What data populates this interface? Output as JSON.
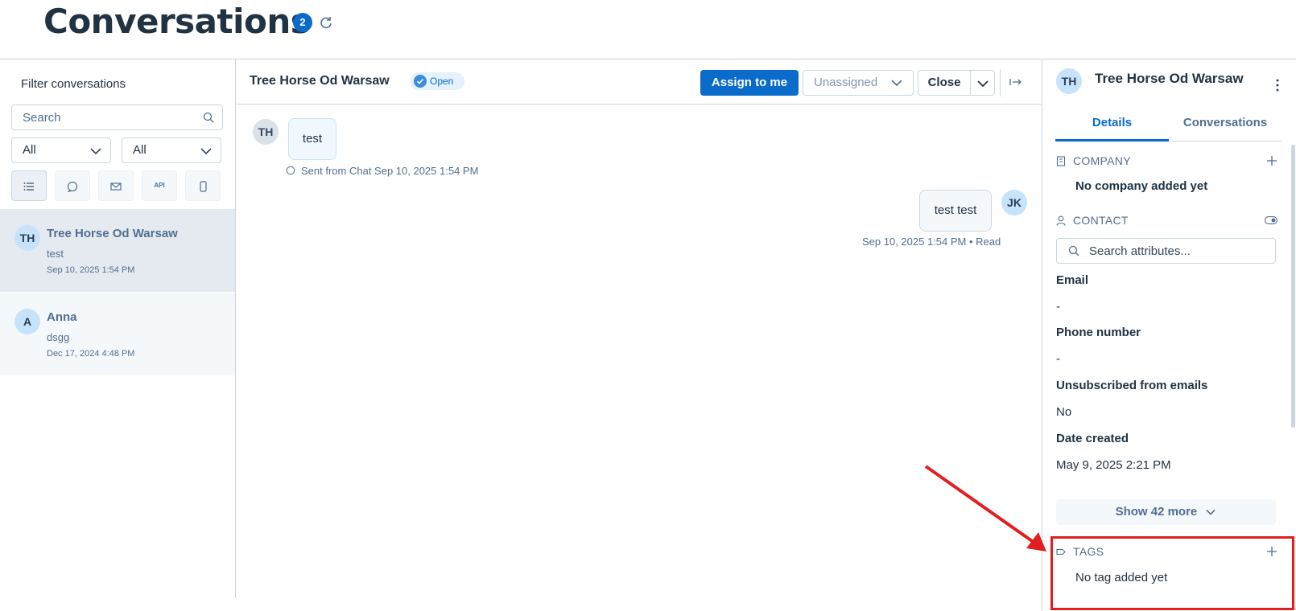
{
  "header": {
    "title": "Conversations",
    "count": "2"
  },
  "filter": {
    "title": "Filter conversations",
    "search_placeholder": "Search",
    "select_1": "All",
    "select_2": "All",
    "channels": [
      "list-icon",
      "chat-icon",
      "email-icon",
      "API",
      "mobile-icon"
    ]
  },
  "conversations": [
    {
      "initials": "TH",
      "name": "Tree Horse Od Warsaw",
      "snippet": "test",
      "date": "Sep 10, 2025 1:54 PM"
    },
    {
      "initials": "A",
      "name": "Anna",
      "snippet": "dsgg",
      "date": "Dec 17, 2024 4:48 PM"
    }
  ],
  "thread": {
    "title": "Tree Horse Od Warsaw",
    "status": "Open",
    "assign_label": "Assign to me",
    "assignee": "Unassigned",
    "close_label": "Close",
    "messages": [
      {
        "initials": "TH",
        "text": "test",
        "meta": "Sent from Chat Sep 10, 2025 1:54 PM"
      },
      {
        "initials": "JK",
        "text": "test test",
        "meta": "Sep 10, 2025 1:54 PM • Read"
      }
    ]
  },
  "sidebar": {
    "initials": "TH",
    "name": "Tree Horse Od Warsaw",
    "tabs": [
      "Details",
      "Conversations"
    ],
    "company": {
      "title": "COMPANY",
      "empty": "No company added yet"
    },
    "contact": {
      "title": "CONTACT",
      "search_placeholder": "Search attributes...",
      "attributes": [
        {
          "label": "Email",
          "value": "-"
        },
        {
          "label": "Phone number",
          "value": "-"
        },
        {
          "label": "Unsubscribed from emails",
          "value": "No"
        },
        {
          "label": "Date created",
          "value": "May 9, 2025 2:21 PM"
        }
      ]
    },
    "show_more": "Show 42 more",
    "tags": {
      "title": "TAGS",
      "empty": "No tag added yet"
    }
  },
  "colors": {
    "accent": "#0b6bcb",
    "annotation": "#e02020"
  }
}
